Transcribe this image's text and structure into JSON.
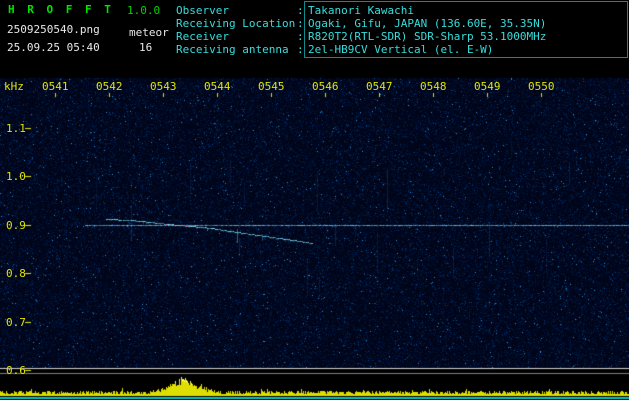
{
  "header": {
    "app_name": "H R O F F T",
    "version": "1.0.0",
    "filename": "2509250540.png",
    "mode": "meteor",
    "datetime": "25.09.25 05:40",
    "count": "16",
    "info_rows": [
      {
        "label": "Observer",
        "sep": ":",
        "value": "Takanori Kawachi"
      },
      {
        "label": "Receiving Location",
        "sep": ":",
        "value": "Ogaki, Gifu, JAPAN (136.60E, 35.35N)"
      },
      {
        "label": "Receiver",
        "sep": ":",
        "value": "R820T2(RTL-SDR) SDR-Sharp 53.1000MHz"
      },
      {
        "label": "Receiving antenna",
        "sep": ":",
        "value": "2el-HB9CV Vertical (el. E-W)"
      }
    ]
  },
  "colors": {
    "title_green": "#00e400",
    "info_cyan": "#38dcdc",
    "axis_yellow": "#e3e300",
    "white_text": "#e8e8e8",
    "info_box_border": "#0e8c8c",
    "spectro_base": "#00051a",
    "carrier_cyan": "#64c8ff",
    "trail_cyan": "#82e1f5",
    "head_echo_red": "#ff5064",
    "noise_bar_yellow": "#dede00",
    "baseline_cyan": "#00c8c8"
  },
  "chart_data": {
    "type": "heatmap",
    "description": "HROFFT meteor-echo radio spectrogram, 10-minute window with bottom signal-level plot",
    "x_axis": {
      "unit": "time HHMM",
      "labels": [
        "0541",
        "0542",
        "0543",
        "0544",
        "0545",
        "0546",
        "0547",
        "0548",
        "0549",
        "0550"
      ]
    },
    "y_axis": {
      "unit": "kHz",
      "labels": [
        "1.1",
        "1.0",
        "0.9",
        "0.8",
        "0.7",
        "0.6"
      ],
      "values": [
        1.1,
        1.0,
        0.9,
        0.8,
        0.7,
        0.6
      ]
    },
    "carrier": {
      "freq_khz": 0.9,
      "start_time": 541.56,
      "end_time": 551.6
    },
    "meteor_trail": {
      "points_time_freq": [
        [
          541.95,
          0.913
        ],
        [
          542.4,
          0.909
        ],
        [
          542.76,
          0.906
        ],
        [
          543.1,
          0.902
        ],
        [
          543.5,
          0.898
        ],
        [
          543.9,
          0.893
        ],
        [
          544.24,
          0.887
        ],
        [
          544.89,
          0.877
        ],
        [
          545.54,
          0.867
        ],
        [
          545.76,
          0.862
        ]
      ]
    },
    "head_echo_dots": [
      [
        543.05,
        0.901
      ],
      [
        543.18,
        0.9
      ],
      [
        543.3,
        0.899
      ],
      [
        543.42,
        0.897
      ]
    ],
    "echo_marks": [
      {
        "t": 544.37,
        "f_top": 0.891,
        "f_bot": 0.862,
        "alpha": 0.45
      },
      {
        "t": 544.83,
        "f_top": 0.881,
        "f_bot": 0.867,
        "alpha": 0.3
      }
    ],
    "noise_plot": {
      "peak_time": 543.4,
      "peak_halfwidth_time": 0.25
    }
  }
}
